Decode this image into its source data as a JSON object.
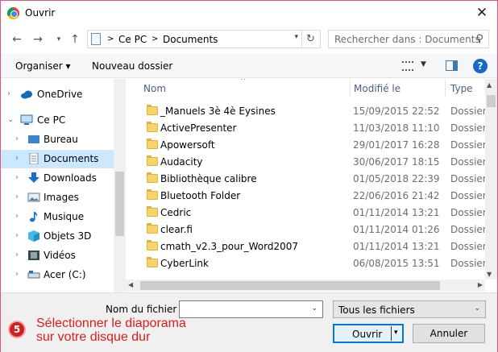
{
  "window": {
    "title": "Ouvrir",
    "close_label": "✕"
  },
  "address": {
    "breadcrumb": [
      "Ce PC",
      "Documents"
    ],
    "separator": ">",
    "search_placeholder": "Rechercher dans : Documents"
  },
  "toolbar": {
    "organize_label": "Organiser ▾",
    "new_folder_label": "Nouveau dossier",
    "help_label": "?"
  },
  "nav": {
    "items": [
      {
        "label": "OneDrive",
        "icon": "cloud-icon"
      },
      {
        "label": "Ce PC",
        "icon": "computer-icon"
      },
      {
        "label": "Bureau",
        "icon": "desktop-icon"
      },
      {
        "label": "Documents",
        "icon": "documents-icon",
        "selected": true
      },
      {
        "label": "Downloads",
        "icon": "download-icon"
      },
      {
        "label": "Images",
        "icon": "images-icon"
      },
      {
        "label": "Musique",
        "icon": "music-icon"
      },
      {
        "label": "Objets 3D",
        "icon": "cube-icon"
      },
      {
        "label": "Vidéos",
        "icon": "video-icon"
      },
      {
        "label": "Acer (C:)",
        "icon": "drive-icon"
      }
    ]
  },
  "files": {
    "columns": {
      "name": "Nom",
      "modified": "Modifié le",
      "type": "Type"
    },
    "rows": [
      {
        "name": "_Manuels 3è 4è Eysines",
        "modified": "15/09/2015 22:52",
        "type": "Dossier d"
      },
      {
        "name": "ActivePresenter",
        "modified": "11/03/2018 11:10",
        "type": "Dossier d"
      },
      {
        "name": "Apowersoft",
        "modified": "29/01/2017 16:28",
        "type": "Dossier d"
      },
      {
        "name": "Audacity",
        "modified": "30/06/2017 18:15",
        "type": "Dossier d"
      },
      {
        "name": "Bibliothèque calibre",
        "modified": "01/05/2018 22:39",
        "type": "Dossier d"
      },
      {
        "name": "Bluetooth Folder",
        "modified": "22/06/2016 21:42",
        "type": "Dossier d"
      },
      {
        "name": "Cedric",
        "modified": "01/11/2014 13:21",
        "type": "Dossier d"
      },
      {
        "name": "clear.fi",
        "modified": "01/11/2014 01:26",
        "type": "Dossier d"
      },
      {
        "name": "cmath_v2.3_pour_Word2007",
        "modified": "01/11/2014 13:21",
        "type": "Dossier d"
      },
      {
        "name": "CyberLink",
        "modified": "06/08/2015 13:51",
        "type": "Dossier d"
      }
    ]
  },
  "bottom": {
    "filename_label": "Nom du fichier :",
    "filename_value": "",
    "filter_value": "Tous les fichiers",
    "open_label": "Ouvrir",
    "cancel_label": "Annuler"
  },
  "annotation": {
    "step_number": "5",
    "line1": "Sélectionner le diaporama",
    "line2": "sur votre disque dur"
  }
}
